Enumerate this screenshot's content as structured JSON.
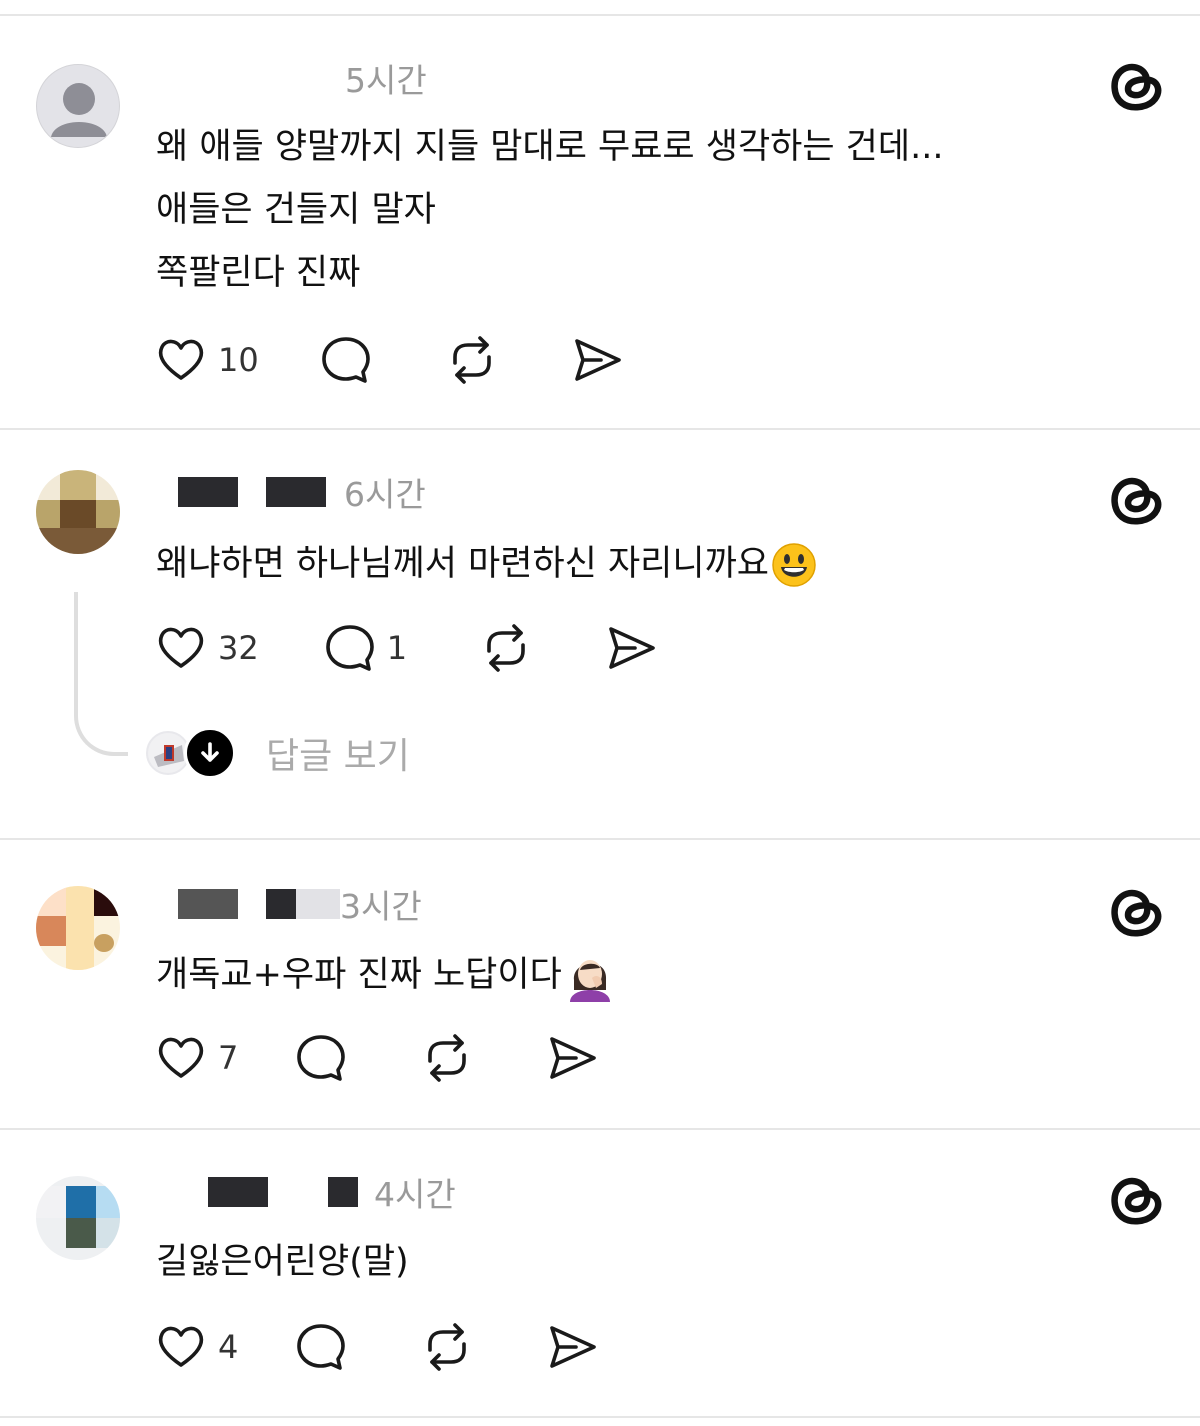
{
  "posts": [
    {
      "time": "5시간",
      "lines": [
        "왜 애들 양말까지 지들 맘대로 무료로 생각하는 건데...",
        "애들은 건들지 말자",
        "쪽팔린다 진짜"
      ],
      "likes": "10",
      "replies": ""
    },
    {
      "time": "6시간",
      "lines": [
        "왜냐하면 하나님께서 마련하신 자리니까요"
      ],
      "emoji": "smiling-face-emoji",
      "likes": "32",
      "replies": "1",
      "view_replies": "답글 보기"
    },
    {
      "time": "3시간",
      "lines": [
        "개독교+우파 진짜 노답이다"
      ],
      "emoji": "facepalm-emoji",
      "likes": "7",
      "replies": ""
    },
    {
      "time": "4시간",
      "lines": [
        "길잃은어린양(말)"
      ],
      "likes": "4",
      "replies": ""
    }
  ],
  "colors": {
    "divider": "#e6e6e6",
    "meta": "#9a9a9a",
    "text": "#111111"
  }
}
